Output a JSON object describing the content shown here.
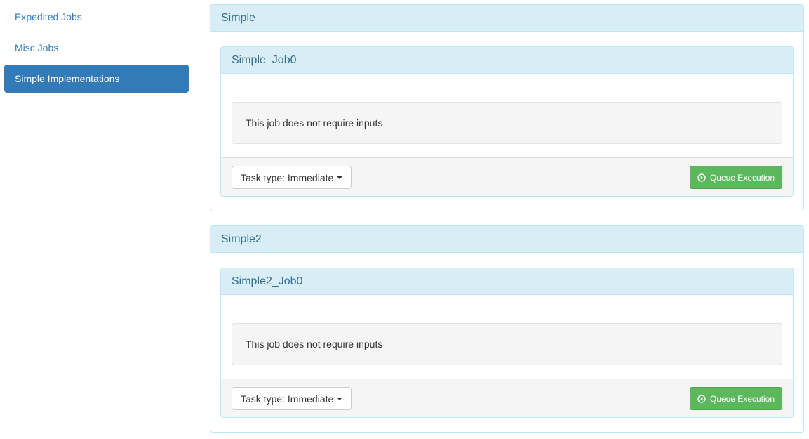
{
  "sidebar": {
    "items": [
      {
        "label": "Expedited Jobs",
        "active": false
      },
      {
        "label": "Misc Jobs",
        "active": false
      },
      {
        "label": "Simple Implementations",
        "active": true
      }
    ]
  },
  "groups": [
    {
      "title": "Simple",
      "job": {
        "title": "Simple_Job0",
        "message": "This job does not require inputs",
        "task_type_label": "Task type: Immediate",
        "queue_label": "Queue Execution"
      }
    },
    {
      "title": "Simple2",
      "job": {
        "title": "Simple2_Job0",
        "message": "This job does not require inputs",
        "task_type_label": "Task type: Immediate",
        "queue_label": "Queue Execution"
      }
    }
  ],
  "icons": {
    "queue": "play-circle-icon",
    "dropdown": "caret-down-icon"
  },
  "colors": {
    "primary": "#337ab7",
    "success": "#5cb85c",
    "info_bg": "#d9edf7",
    "info_text": "#31708f",
    "info_border": "#bce8f1"
  }
}
